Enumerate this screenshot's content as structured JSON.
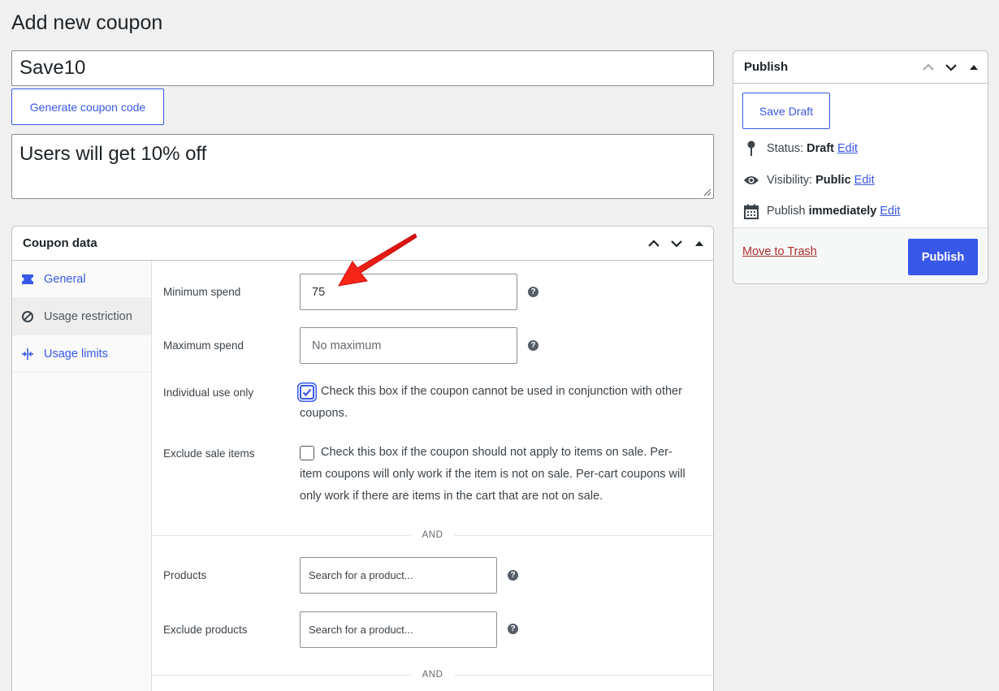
{
  "page": {
    "title": "Add new coupon"
  },
  "coupon": {
    "code": "Save10",
    "generate_label": "Generate coupon code",
    "description": "Users will get 10% off"
  },
  "coupon_data": {
    "title": "Coupon data",
    "tabs": [
      {
        "label": "General",
        "icon": "ticket-icon",
        "active": false
      },
      {
        "label": "Usage restriction",
        "icon": "block-icon",
        "active": true
      },
      {
        "label": "Usage limits",
        "icon": "limits-icon",
        "active": false
      }
    ],
    "fields": {
      "min_spend": {
        "label": "Minimum spend",
        "value": "75"
      },
      "max_spend": {
        "label": "Maximum spend",
        "placeholder": "No maximum"
      },
      "individual": {
        "label": "Individual use only",
        "text": "Check this box if the coupon cannot be used in conjunction with other coupons.",
        "checked": true
      },
      "exclude_sale": {
        "label": "Exclude sale items",
        "text": "Check this box if the coupon should not apply to items on sale. Per-item coupons will only work if the item is not on sale. Per-cart coupons will only work if there are items in the cart that are not on sale.",
        "checked": false
      },
      "products": {
        "label": "Products",
        "placeholder": "Search for a product..."
      },
      "exclude_products": {
        "label": "Exclude products",
        "placeholder": "Search for a product..."
      }
    },
    "and_label": "AND"
  },
  "publish": {
    "title": "Publish",
    "save_draft": "Save Draft",
    "status_label": "Status:",
    "status_value": "Draft",
    "visibility_label": "Visibility:",
    "visibility_value": "Public",
    "schedule_label": "Publish",
    "schedule_value": "immediately",
    "edit_label": "Edit",
    "trash_label": "Move to Trash",
    "publish_label": "Publish"
  },
  "colors": {
    "accent": "#3858e9",
    "danger": "#b32d2e",
    "arrow": "#e8191a"
  }
}
